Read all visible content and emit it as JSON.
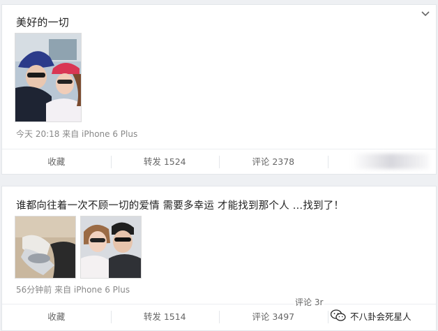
{
  "posts": [
    {
      "text": "美好的一切",
      "meta": "今天 20:18 来自 iPhone 6 Plus",
      "actions": {
        "favorite": "收藏",
        "repost": "转发 1524",
        "comment": "评论 2378"
      }
    },
    {
      "text": "谁都向往着一次不顾一切的爱情 需要多幸运 才能找到那个人 …找到了！",
      "meta": "56分钟前 来自 iPhone 6 Plus",
      "actions": {
        "favorite": "收藏",
        "repost": "转发 1514",
        "comment": "评论 3497"
      }
    }
  ],
  "overlay": {
    "comment_fragment": "评论 3r"
  },
  "watermark": {
    "text": "不八卦会死星人"
  },
  "colors": {
    "background": "#eef0f3",
    "card": "#ffffff",
    "meta_text": "#888888"
  }
}
